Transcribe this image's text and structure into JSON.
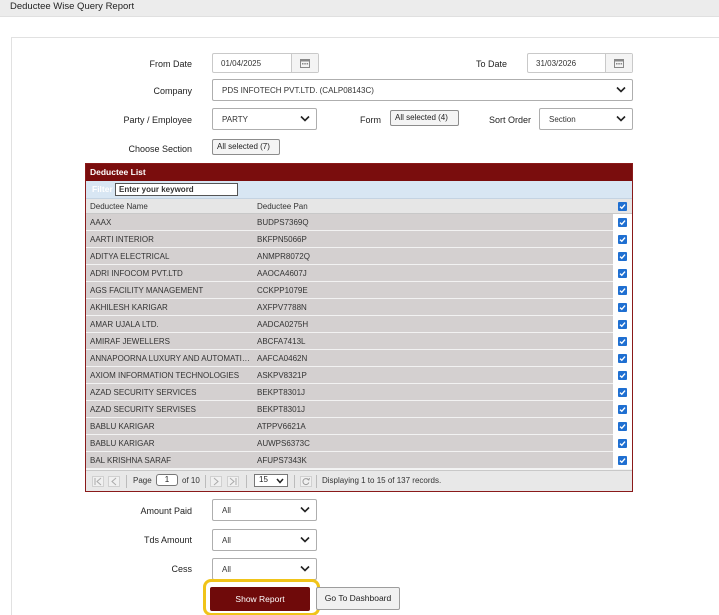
{
  "page": {
    "title": "Deductee Wise Query Report"
  },
  "filters": {
    "from_date_label": "From Date",
    "from_date_value": "01/04/2025",
    "to_date_label": "To Date",
    "to_date_value": "31/03/2026",
    "company_label": "Company",
    "company_value": "PDS INFOTECH PVT.LTD. (CALP08143C)",
    "party_label": "Party / Employee",
    "party_value": "PARTY",
    "form_label": "Form",
    "form_value": "All selected (4)",
    "sort_label": "Sort Order",
    "sort_value": "Section",
    "section_label": "Choose Section",
    "section_value": "All selected (7)"
  },
  "grid": {
    "title": "Deductee List",
    "filter_label": "Filter",
    "filter_placeholder": "Enter your keyword",
    "columns": [
      "Deductee Name",
      "Deductee Pan"
    ],
    "rows": [
      {
        "name": "AAAX",
        "pan": "BUDPS7369Q"
      },
      {
        "name": "AARTI INTERIOR",
        "pan": "BKFPN5066P"
      },
      {
        "name": "ADITYA ELECTRICAL",
        "pan": "ANMPR8072Q"
      },
      {
        "name": "ADRI INFOCOM PVT.LTD",
        "pan": "AAOCA4607J"
      },
      {
        "name": "AGS FACILITY MANAGEMENT",
        "pan": "CCKPP1079E"
      },
      {
        "name": "AKHILESH KARIGAR",
        "pan": "AXFPV7788N"
      },
      {
        "name": "AMAR UJALA LTD.",
        "pan": "AADCA0275H"
      },
      {
        "name": "AMIRAF JEWELLERS",
        "pan": "ABCFA7413L"
      },
      {
        "name": "ANNAPOORNA LUXURY AND AUTOMATION",
        "pan": "AAFCA0462N"
      },
      {
        "name": "AXIOM INFORMATION TECHNOLOGIES",
        "pan": "ASKPV8321P"
      },
      {
        "name": "AZAD SECURITY SERVICES",
        "pan": "BEKPT8301J"
      },
      {
        "name": "AZAD SECURITY SERVISES",
        "pan": "BEKPT8301J"
      },
      {
        "name": "BABLU KARIGAR",
        "pan": "ATPPV6621A"
      },
      {
        "name": "BABLU KARIGAR",
        "pan": "AUWPS6373C"
      },
      {
        "name": "BAL KRISHNA SARAF",
        "pan": "AFUPS7343K"
      }
    ],
    "pager": {
      "page_label": "Page",
      "page_value": "1",
      "of_label": "of 10",
      "page_size": "15",
      "status": "Displaying 1 to 15 of 137 records."
    }
  },
  "bottom_filters": {
    "amount_paid_label": "Amount Paid",
    "amount_paid_value": "All",
    "tds_amount_label": "Tds Amount",
    "tds_amount_value": "All",
    "cess_label": "Cess",
    "cess_value": "All"
  },
  "actions": {
    "show_report": "Show Report",
    "go_dashboard": "Go To Dashboard"
  },
  "colors": {
    "header_maroon": "#7a0d0d",
    "button_maroon": "#6f0a0a",
    "highlight": "#f0c419",
    "checkbox_blue": "#1f6fd1",
    "row_bg": "#d4d0d0",
    "filter_bar": "#d8e6f3"
  },
  "icons": [
    "calendar-icon",
    "chevron-down-icon",
    "checkbox-checked-icon",
    "first-page-icon",
    "prev-page-icon",
    "next-page-icon",
    "last-page-icon",
    "refresh-icon"
  ]
}
